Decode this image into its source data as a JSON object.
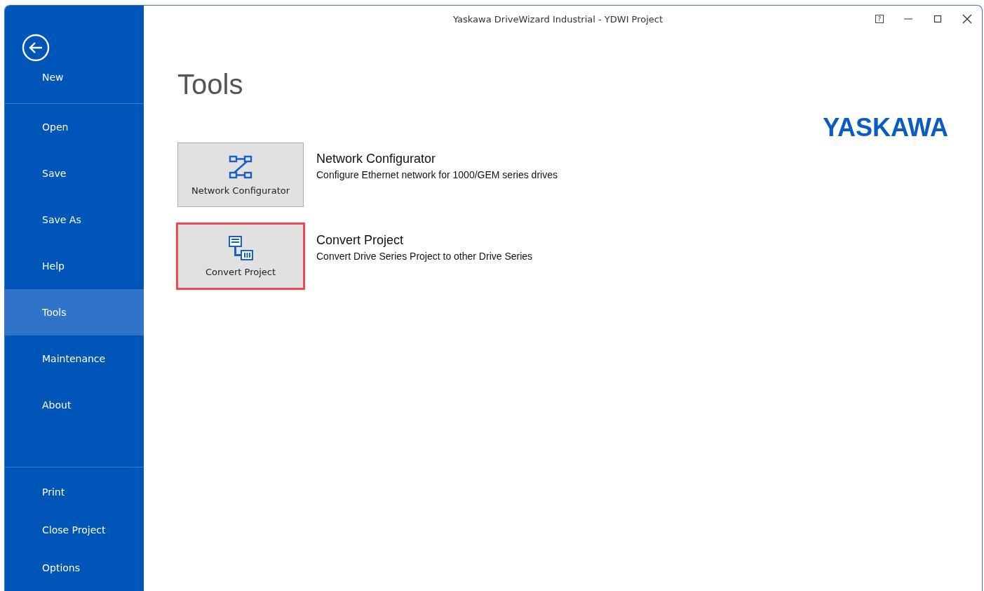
{
  "window": {
    "title": "Yaskawa DriveWizard Industrial - YDWI Project",
    "help": "?"
  },
  "sidebar": {
    "sections": [
      [
        {
          "label": "New",
          "selected": false
        }
      ],
      [
        {
          "label": "Open",
          "selected": false
        },
        {
          "label": "Save",
          "selected": false
        },
        {
          "label": "Save As",
          "selected": false
        },
        {
          "label": "Help",
          "selected": false
        },
        {
          "label": "Tools",
          "selected": true
        },
        {
          "label": "Maintenance",
          "selected": false
        },
        {
          "label": "About",
          "selected": false
        }
      ],
      [
        {
          "label": "Print",
          "selected": false
        },
        {
          "label": "Close Project",
          "selected": false
        },
        {
          "label": "Options",
          "selected": false
        }
      ]
    ]
  },
  "page": {
    "heading": "Tools",
    "logo": "YASKAWA"
  },
  "tools": [
    {
      "kind": "network",
      "button": "Network Configurator",
      "title": "Network Configurator",
      "description": "Configure Ethernet network for 1000/GEM series drives",
      "selected": false
    },
    {
      "kind": "convert",
      "button": "Convert Project",
      "title": "Convert Project",
      "description": "Convert Drive Series Project to other Drive Series",
      "selected": true
    }
  ]
}
